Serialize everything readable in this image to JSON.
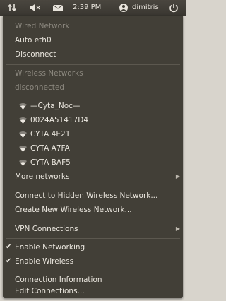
{
  "panel": {
    "time": "2:39 PM",
    "user": "dimitris"
  },
  "menu": {
    "wired_header": "Wired Network",
    "auto_eth0": "Auto eth0",
    "disconnect": "Disconnect",
    "wireless_header": "Wireless Networks",
    "wireless_status": "disconnected",
    "networks": [
      "—Cyta_Noc—",
      "0024A51417D4",
      "CYTA 4E21",
      "CYTA A7FA",
      "CYTA BAF5"
    ],
    "more_networks": "More networks",
    "connect_hidden": "Connect to Hidden Wireless Network...",
    "create_new": "Create New Wireless Network...",
    "vpn": "VPN Connections",
    "enable_networking": "Enable Networking",
    "enable_wireless": "Enable Wireless",
    "connection_info": "Connection Information",
    "edit_connections": "Edit Connections...",
    "enable_networking_checked": true,
    "enable_wireless_checked": true
  },
  "icons": {
    "network": "network-updown-icon",
    "sound": "speaker-icon",
    "mail": "envelope-icon",
    "user": "user-icon",
    "power": "power-icon",
    "wifi": "wifi-signal-icon",
    "submenu": "chevron-right-icon",
    "check": "checkmark-icon"
  },
  "colors": {
    "menu_bg": "#423f37",
    "panel_bg": "#3f3c35",
    "text": "#ebe7df",
    "disabled": "#8c887f"
  }
}
